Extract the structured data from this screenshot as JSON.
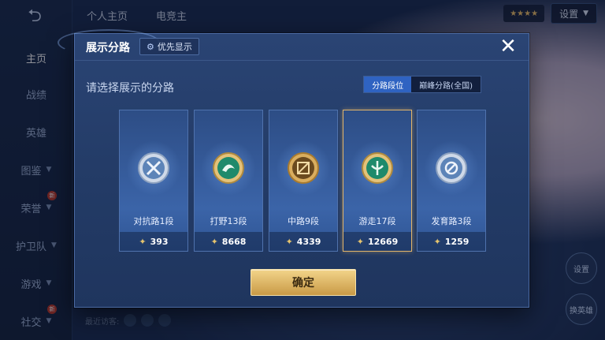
{
  "background": {
    "back_glyph": "⮌",
    "sidebar": [
      {
        "label": "主页",
        "active": true
      },
      {
        "label": "战绩"
      },
      {
        "label": "英雄"
      },
      {
        "label": "图鉴"
      },
      {
        "label": "荣誉",
        "badge": "新"
      },
      {
        "label": "护卫队"
      },
      {
        "label": "游戏"
      },
      {
        "label": "社交",
        "badge": "新"
      }
    ],
    "top_tabs": [
      "个人主页",
      "电竞主"
    ],
    "top_right": {
      "badge_text": "★★★★",
      "settings_label": "设置"
    },
    "recent_label": "最近访客:",
    "right_buttons": [
      "设置",
      "换英雄"
    ]
  },
  "modal": {
    "title": "展示分路",
    "priority_label": "优先显示",
    "close_glyph": "✕",
    "subtitle": "请选择展示的分路",
    "segments": [
      {
        "label": "分路段位",
        "active": true
      },
      {
        "label": "巅峰分路(全国)",
        "active": false
      }
    ],
    "cards": [
      {
        "label": "对抗路1段",
        "score": "393",
        "icon": "sword-emblem-icon",
        "selected": false
      },
      {
        "label": "打野13段",
        "score": "8668",
        "icon": "jungle-emblem-icon",
        "selected": false
      },
      {
        "label": "中路9段",
        "score": "4339",
        "icon": "mid-emblem-icon",
        "selected": false
      },
      {
        "label": "游走17段",
        "score": "12669",
        "icon": "roam-emblem-icon",
        "selected": true
      },
      {
        "label": "发育路3段",
        "score": "1259",
        "icon": "adc-emblem-icon",
        "selected": false
      }
    ],
    "confirm_label": "确定"
  },
  "colors": {
    "accent_gold": "#e2b56a",
    "segment_active": "#2f63c2",
    "panel": "#2a4474"
  }
}
